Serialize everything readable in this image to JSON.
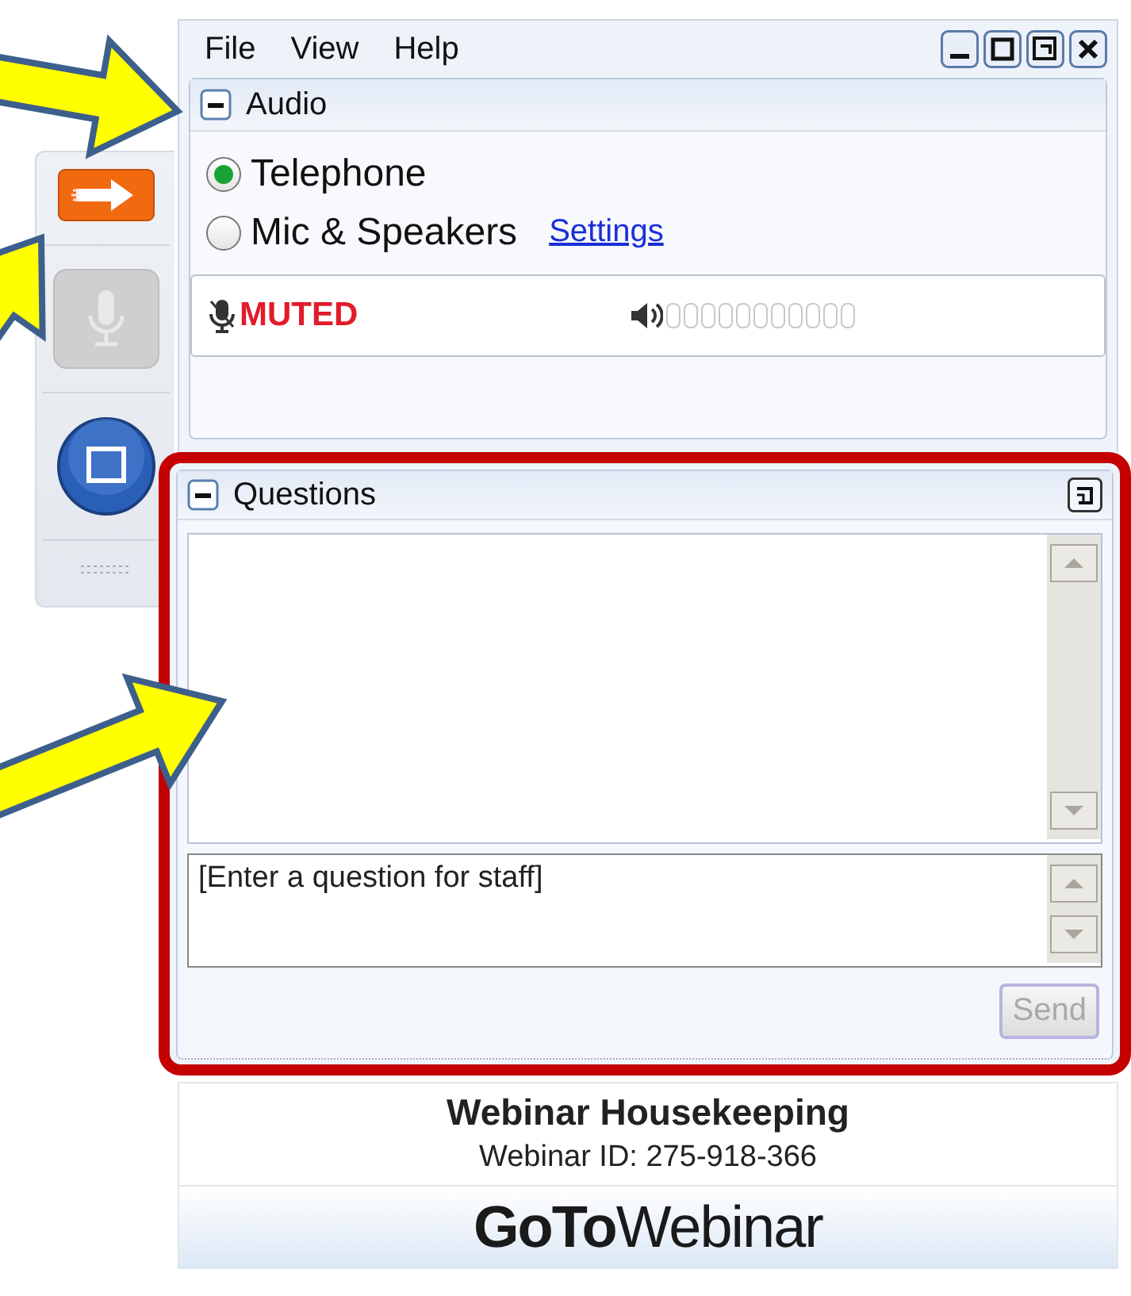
{
  "menu": [
    "File",
    "View",
    "Help"
  ],
  "audio": {
    "title": "Audio",
    "options": [
      {
        "label": "Telephone",
        "selected": true
      },
      {
        "label": "Mic & Speakers",
        "selected": false,
        "link": "Settings"
      }
    ],
    "status": "MUTED"
  },
  "questions": {
    "title": "Questions",
    "placeholder": "[Enter a question for staff]",
    "send": {
      "label": "Send",
      "disabled": true
    }
  },
  "footer": {
    "title": "Webinar Housekeeping",
    "webinar_id": "Webinar ID: 275-918-366",
    "logo": "**GoTo**Webinar"
  }
}
